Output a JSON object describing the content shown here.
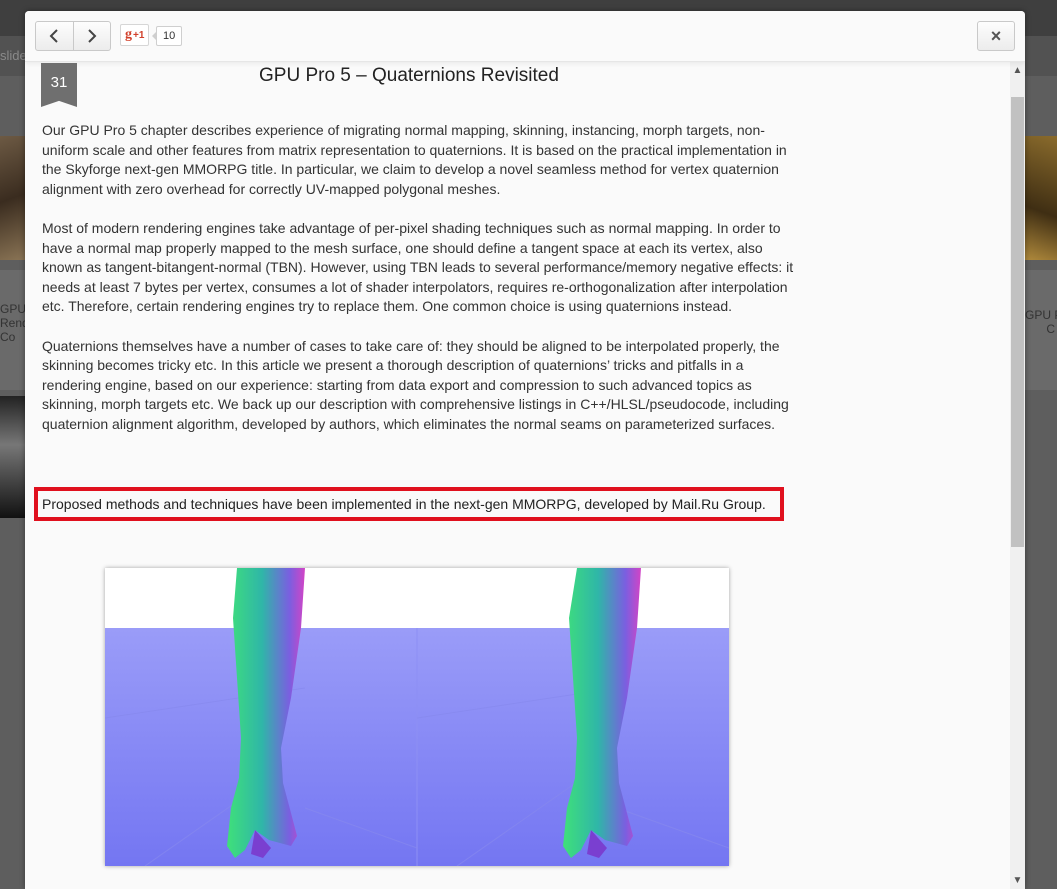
{
  "background": {
    "slide_text": "slide",
    "left_card_text": "GPU\nRende\nCo",
    "right_card_text": "GPU P\nC"
  },
  "header": {
    "prev_icon": "chevron-left-icon",
    "next_icon": "chevron-right-icon",
    "gplus_label": "g",
    "gplus_plus": "+1",
    "gplus_count": "10",
    "close_icon": "×"
  },
  "slide": {
    "number": "31",
    "title": "GPU Pro 5 – Quaternions Revisited",
    "paragraphs": [
      "Our GPU Pro 5 chapter describes experience of migrating normal mapping, skinning, instancing, morph targets, non-uniform scale and other features from matrix representation to quaternions. It is based on the practical implementation in the Skyforge next-gen MMORPG title. In particular, we claim to develop a novel seamless method for vertex quaternion alignment with zero overhead for correctly UV-mapped polygonal meshes.",
      "Most of modern rendering engines take advantage of per-pixel shading techniques such as normal mapping. In order to have a normal map properly mapped to the mesh surface, one should define a tangent space at each its vertex, also known as tangent-bitangent-normal (TBN). However, using TBN leads to several performance/memory negative effects: it needs at least 7 bytes per vertex, consumes a lot of shader interpolators, requires re-orthogonalization after interpolation etc. Therefore, certain rendering engines try to replace them. One common choice is using quaternions instead.",
      "Quaternions themselves have a number of cases to take care of: they should be aligned to be interpolated properly, the skinning becomes tricky etc. In this article we present a thorough description of quaternions’ tricks and pitfalls in a rendering engine, based on our experience: starting from data export and compression to such advanced topics as skinning, morph targets etc. We back up our description with comprehensive listings in C++/HLSL/pseudocode, including quaternion alignment algorithm, developed by authors, which eliminates the normal seams on parameterized surfaces."
    ],
    "highlighted": "Proposed methods and techniques have been implemented in the next-gen MMORPG, developed by Mail.Ru Group."
  },
  "colors": {
    "highlight_border": "#e0101e",
    "normal_map_floor": "#8080f8",
    "normal_map_green": "#3ed48a",
    "normal_map_magenta": "#c050d0"
  },
  "scrollbar": {
    "up_icon": "▲",
    "down_icon": "▼"
  }
}
